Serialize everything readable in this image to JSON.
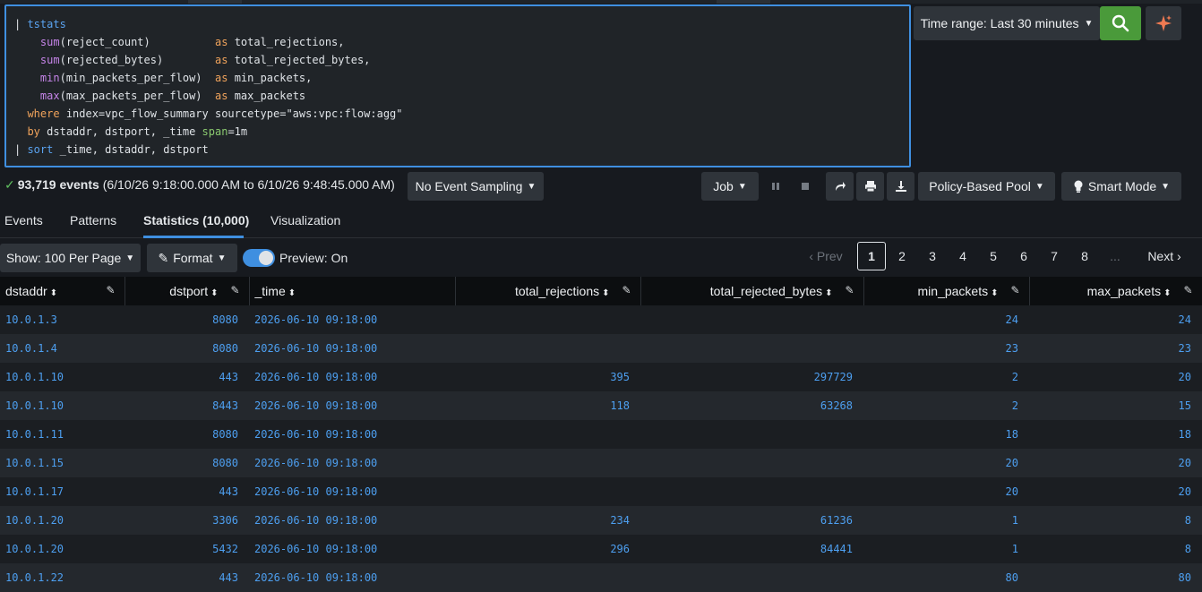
{
  "query": {
    "line1_cmd": "tstats",
    "fields": [
      {
        "fn": "sum",
        "arg": "(reject_count)",
        "pad": "          ",
        "as": "as",
        "alias": "total_rejections,"
      },
      {
        "fn": "sum",
        "arg": "(rejected_bytes)",
        "pad": "        ",
        "as": "as",
        "alias": "total_rejected_bytes,"
      },
      {
        "fn": "min",
        "arg": "(min_packets_per_flow)",
        "pad": "  ",
        "as": "as",
        "alias": "min_packets,"
      },
      {
        "fn": "max",
        "arg": "(max_packets_per_flow)",
        "pad": "  ",
        "as": "as",
        "alias": "max_packets"
      }
    ],
    "where_kw": "where",
    "where_rest_1": "index=vpc_flow_summary sourcetype=\"aws:vpc:flow:agg\"",
    "by_kw": "by",
    "by_rest_1": "dstaddr, dstport, _time",
    "span_kw": "span",
    "span_val": "=1m",
    "sort_cmd": "sort",
    "sort_rest": "_time, dstaddr, dstport"
  },
  "toolbar": {
    "time_range_label": "Time range: Last 30 minutes",
    "search_icon": "search-icon",
    "ai_icon": "sparkle-icon"
  },
  "status": {
    "event_count": "93,719 events",
    "event_range": "(6/10/26 9:18:00.000 AM to 6/10/26 9:48:45.000 AM)",
    "sampling_label": "No Event Sampling",
    "job_label": "Job",
    "pool_label": "Policy-Based Pool",
    "mode_label": "Smart Mode"
  },
  "tabs": [
    {
      "label": "Events"
    },
    {
      "label": "Patterns"
    },
    {
      "label": "Statistics (10,000)"
    },
    {
      "label": "Visualization"
    }
  ],
  "controls": {
    "per_page_label": "Show: 100 Per Page",
    "format_label": "Format",
    "preview_label": "Preview: On",
    "prev_label": "Prev",
    "next_label": "Next",
    "pages": [
      "1",
      "2",
      "3",
      "4",
      "5",
      "6",
      "7",
      "8"
    ],
    "ellipsis": "..."
  },
  "table": {
    "columns": [
      "dstaddr",
      "dstport",
      "_time",
      "total_rejections",
      "total_rejected_bytes",
      "min_packets",
      "max_packets"
    ],
    "rows": [
      [
        "10.0.1.3",
        "8080",
        "2026-06-10 09:18:00",
        "",
        "",
        "24",
        "24"
      ],
      [
        "10.0.1.4",
        "8080",
        "2026-06-10 09:18:00",
        "",
        "",
        "23",
        "23"
      ],
      [
        "10.0.1.10",
        "443",
        "2026-06-10 09:18:00",
        "395",
        "297729",
        "2",
        "20"
      ],
      [
        "10.0.1.10",
        "8443",
        "2026-06-10 09:18:00",
        "118",
        "63268",
        "2",
        "15"
      ],
      [
        "10.0.1.11",
        "8080",
        "2026-06-10 09:18:00",
        "",
        "",
        "18",
        "18"
      ],
      [
        "10.0.1.15",
        "8080",
        "2026-06-10 09:18:00",
        "",
        "",
        "20",
        "20"
      ],
      [
        "10.0.1.17",
        "443",
        "2026-06-10 09:18:00",
        "",
        "",
        "20",
        "20"
      ],
      [
        "10.0.1.20",
        "3306",
        "2026-06-10 09:18:00",
        "234",
        "61236",
        "1",
        "8"
      ],
      [
        "10.0.1.20",
        "5432",
        "2026-06-10 09:18:00",
        "296",
        "84441",
        "1",
        "8"
      ],
      [
        "10.0.1.22",
        "443",
        "2026-06-10 09:18:00",
        "",
        "",
        "80",
        "80"
      ]
    ]
  }
}
